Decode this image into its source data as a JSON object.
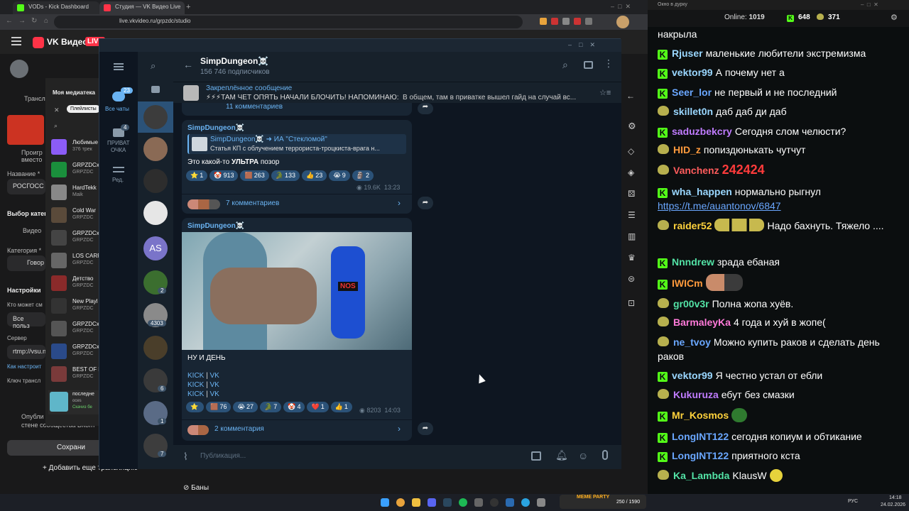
{
  "browser": {
    "tabs": [
      {
        "label": "VODs - Kick Dashboard"
      },
      {
        "label": "Студия — VK Видео Live"
      }
    ],
    "url": "live.vkvideo.ru/grpzdc/studio"
  },
  "vk": {
    "logo": "VK Видео",
    "live_badge": "LIVE",
    "side": {
      "broadcast": "Трансл",
      "play_label": "Проигр",
      "play_label2": "вместо",
      "name_label": "Название *",
      "name_value": "РОСГОСС",
      "category_choose": "Выбор катег",
      "video_label": "Видео",
      "category_label": "Категория *",
      "category_value": "Говор",
      "settings": "Настройки",
      "who_can": "Кто может см",
      "who_value": "Все польз",
      "server": "Сервер",
      "server_value": "rtmp://vsu.n",
      "how_setup": "Как настроит",
      "key": "Ключ трансл",
      "publish": "Опубли",
      "publish2": "стене сообщества ВКонт",
      "save": "Сохрани",
      "add_more": "Добавить еще трансляцию",
      "bans": "Баны"
    },
    "media": {
      "title": "Моя медиатека",
      "filter": "Плейлисты",
      "items": [
        {
          "title": "Любимые",
          "sub": "376 трек"
        },
        {
          "title": "GRPZDCx",
          "sub": "GRPZDC"
        },
        {
          "title": "HardTekk",
          "sub": "Maik"
        },
        {
          "title": "Cold War",
          "sub": "GRPZDC"
        },
        {
          "title": "GRPZDCx",
          "sub": "GRPZDC"
        },
        {
          "title": "LOS CARF",
          "sub": "GRPZDC"
        },
        {
          "title": "Детство",
          "sub": "GRPZDC"
        },
        {
          "title": "New Playl",
          "sub": "GRPZDC"
        },
        {
          "title": "GRPZDCx",
          "sub": "GRPZDC"
        },
        {
          "title": "GRPZDCx",
          "sub": "GRPZDC"
        },
        {
          "title": "BEST OF M",
          "sub": "GRPZDC"
        }
      ],
      "now_playing": "последне",
      "now_playing_sub": "oces",
      "now_playing_sub2": "Скачиз бе"
    }
  },
  "tg": {
    "rail": {
      "all_chats": "Все чаты",
      "all_chats_badge": "23",
      "private": "ПРИВАТ",
      "private2": "ОЧКА",
      "private_badge": "4",
      "edit": "Ред."
    },
    "chat_badges": [
      "AS",
      "2",
      "4303",
      "6",
      "1",
      "7"
    ],
    "channel": {
      "name": "SimpDungeon☠️",
      "subscribers": "156 746 подписчиков"
    },
    "pinned": {
      "label": "Закреплённое сообщение",
      "text": "⚡⚡⚡ТАМ ЧЕТ ОПЯТЬ НАЧАЛИ БЛОЧИТЬ! НАПОМИНАЮ:",
      "text2": "В общем, там в приватке вышел гайд на случай вс..."
    },
    "prev_comments": "11 комментариев",
    "post1": {
      "author": "SimpDungeon☠️",
      "fwd_from": "SimpDungeon☠️",
      "fwd_arrow": "➜ ИА \"Стекломой\"",
      "fwd_text": "Статья КП с облучением террориста-троцкиста-врага н...",
      "text_before": "Это какой-то ",
      "text_bold": "УЛЬТРА",
      "text_after": " позор",
      "reactions": [
        {
          "emoji": "⭐",
          "count": "1"
        },
        {
          "emoji": "🤡",
          "count": "913"
        },
        {
          "emoji": "🟫",
          "count": "263"
        },
        {
          "emoji": "🐊",
          "count": "133"
        },
        {
          "emoji": "👍",
          "count": "23"
        },
        {
          "emoji": "😭",
          "count": "9"
        },
        {
          "emoji": "🗿",
          "count": "2"
        }
      ],
      "views": "19.6K",
      "time": "13:23",
      "comments": "7 комментариев"
    },
    "post2": {
      "author": "SimpDungeon☠️",
      "text": "НУ И ДЕНЬ",
      "links": [
        {
          "a": "KICK",
          "sep": " | ",
          "b": "VK"
        },
        {
          "a": "KICK",
          "sep": " | ",
          "b": "VK"
        },
        {
          "a": "KICK",
          "sep": " | ",
          "b": "VK"
        }
      ],
      "reactions": [
        {
          "emoji": "⭐",
          "count": ""
        },
        {
          "emoji": "🟫",
          "count": "76"
        },
        {
          "emoji": "😭",
          "count": "27"
        },
        {
          "emoji": "🐊",
          "count": "7"
        },
        {
          "emoji": "🤡",
          "count": "4"
        },
        {
          "emoji": "❤️",
          "count": "1"
        },
        {
          "emoji": "👍",
          "count": "1"
        }
      ],
      "views": "8203",
      "time": "14:03",
      "comments": "2 комментария",
      "nos_label": "NOS"
    },
    "input_placeholder": "Публикация..."
  },
  "stream_chat": {
    "window_title": "Окно в дурку",
    "online_label": "Online:",
    "online_value": "1019",
    "count1": "648",
    "count2": "371",
    "messages": [
      {
        "badge": "none",
        "user": "",
        "color": "#ffffff",
        "text": "накрыла"
      },
      {
        "badge": "kick",
        "user": "Rjuser",
        "color": "#9ad7ff",
        "text": "маленькие любители экстремизма"
      },
      {
        "badge": "kick",
        "user": "vektor99",
        "color": "#9ad7ff",
        "text": "А почему нет а"
      },
      {
        "badge": "kick",
        "user": "Seer_lor",
        "color": "#6aa7ff",
        "text": "не первый и не последний"
      },
      {
        "badge": "pepe",
        "user": "skillet0n",
        "color": "#9ad7ff",
        "text": "даб даб ди даб"
      },
      {
        "badge": "kick",
        "user": "saduzbekcry",
        "color": "#c07cff",
        "text": "Сегодня слом челюсти?"
      },
      {
        "badge": "pepe",
        "user": "HID_z",
        "color": "#ff9a3c",
        "text": "попиздюнькать чутчут"
      },
      {
        "badge": "pepe",
        "user": "Vanchenz",
        "color": "#ff5c5c",
        "text": "242424"
      },
      {
        "badge": "kick",
        "user": "wha_happen",
        "color": "#9ad7ff",
        "text": "нормально рыгнул"
      },
      {
        "badge": "none",
        "user": "",
        "color": "#6aa7ff",
        "text": "https://t.me/auantonov/6847"
      },
      {
        "badge": "pepe",
        "user": "raider52",
        "color": "#ffd23c",
        "text": "Надо бахнуть. Тяжело ...."
      },
      {
        "badge": "kick",
        "user": "Nnndrew",
        "color": "#53e3a6",
        "text": "зрада ебаная"
      },
      {
        "badge": "kick",
        "user": "IWICm",
        "color": "#ff9a3c",
        "text": ""
      },
      {
        "badge": "pepe",
        "user": "gr00v3r",
        "color": "#53e3a6",
        "text": "Полна жопа хуёв."
      },
      {
        "badge": "pepe",
        "user": "BarmaleyKa",
        "color": "#ff7ad9",
        "text": "4 года и хуй в жопе("
      },
      {
        "badge": "pepe",
        "user": "ne_tvoy",
        "color": "#6aa7ff",
        "text": "Можно купить раков и сделать день раков"
      },
      {
        "badge": "kick",
        "user": "vektor99",
        "color": "#9ad7ff",
        "text": "Я честно устал от ебли"
      },
      {
        "badge": "pepe",
        "user": "Kukuruza",
        "color": "#c07cff",
        "text": "ебут без смазки"
      },
      {
        "badge": "kick",
        "user": "Mr_Kosmos",
        "color": "#ffd23c",
        "text": ""
      },
      {
        "badge": "kick",
        "user": "LongINT122",
        "color": "#6aa7ff",
        "text": "сегодня копиум и обтикание"
      },
      {
        "badge": "kick",
        "user": "LongINT122",
        "color": "#6aa7ff",
        "text": "приятного кста"
      },
      {
        "badge": "pepe",
        "user": "Ka_Lambda",
        "color": "#53e3a6",
        "text": "KlausW"
      }
    ]
  },
  "taskbar": {
    "widget_title": "MEME PARTY",
    "widget_value": "250 / 1590",
    "lang": "РУС",
    "time": "14:18",
    "date": "24.02.2026"
  },
  "colors": {
    "kick_green": "#53fc18",
    "tg_accent": "#6ab3f2",
    "tg_bg": "#0e1621",
    "vk_red": "#ff3347"
  }
}
